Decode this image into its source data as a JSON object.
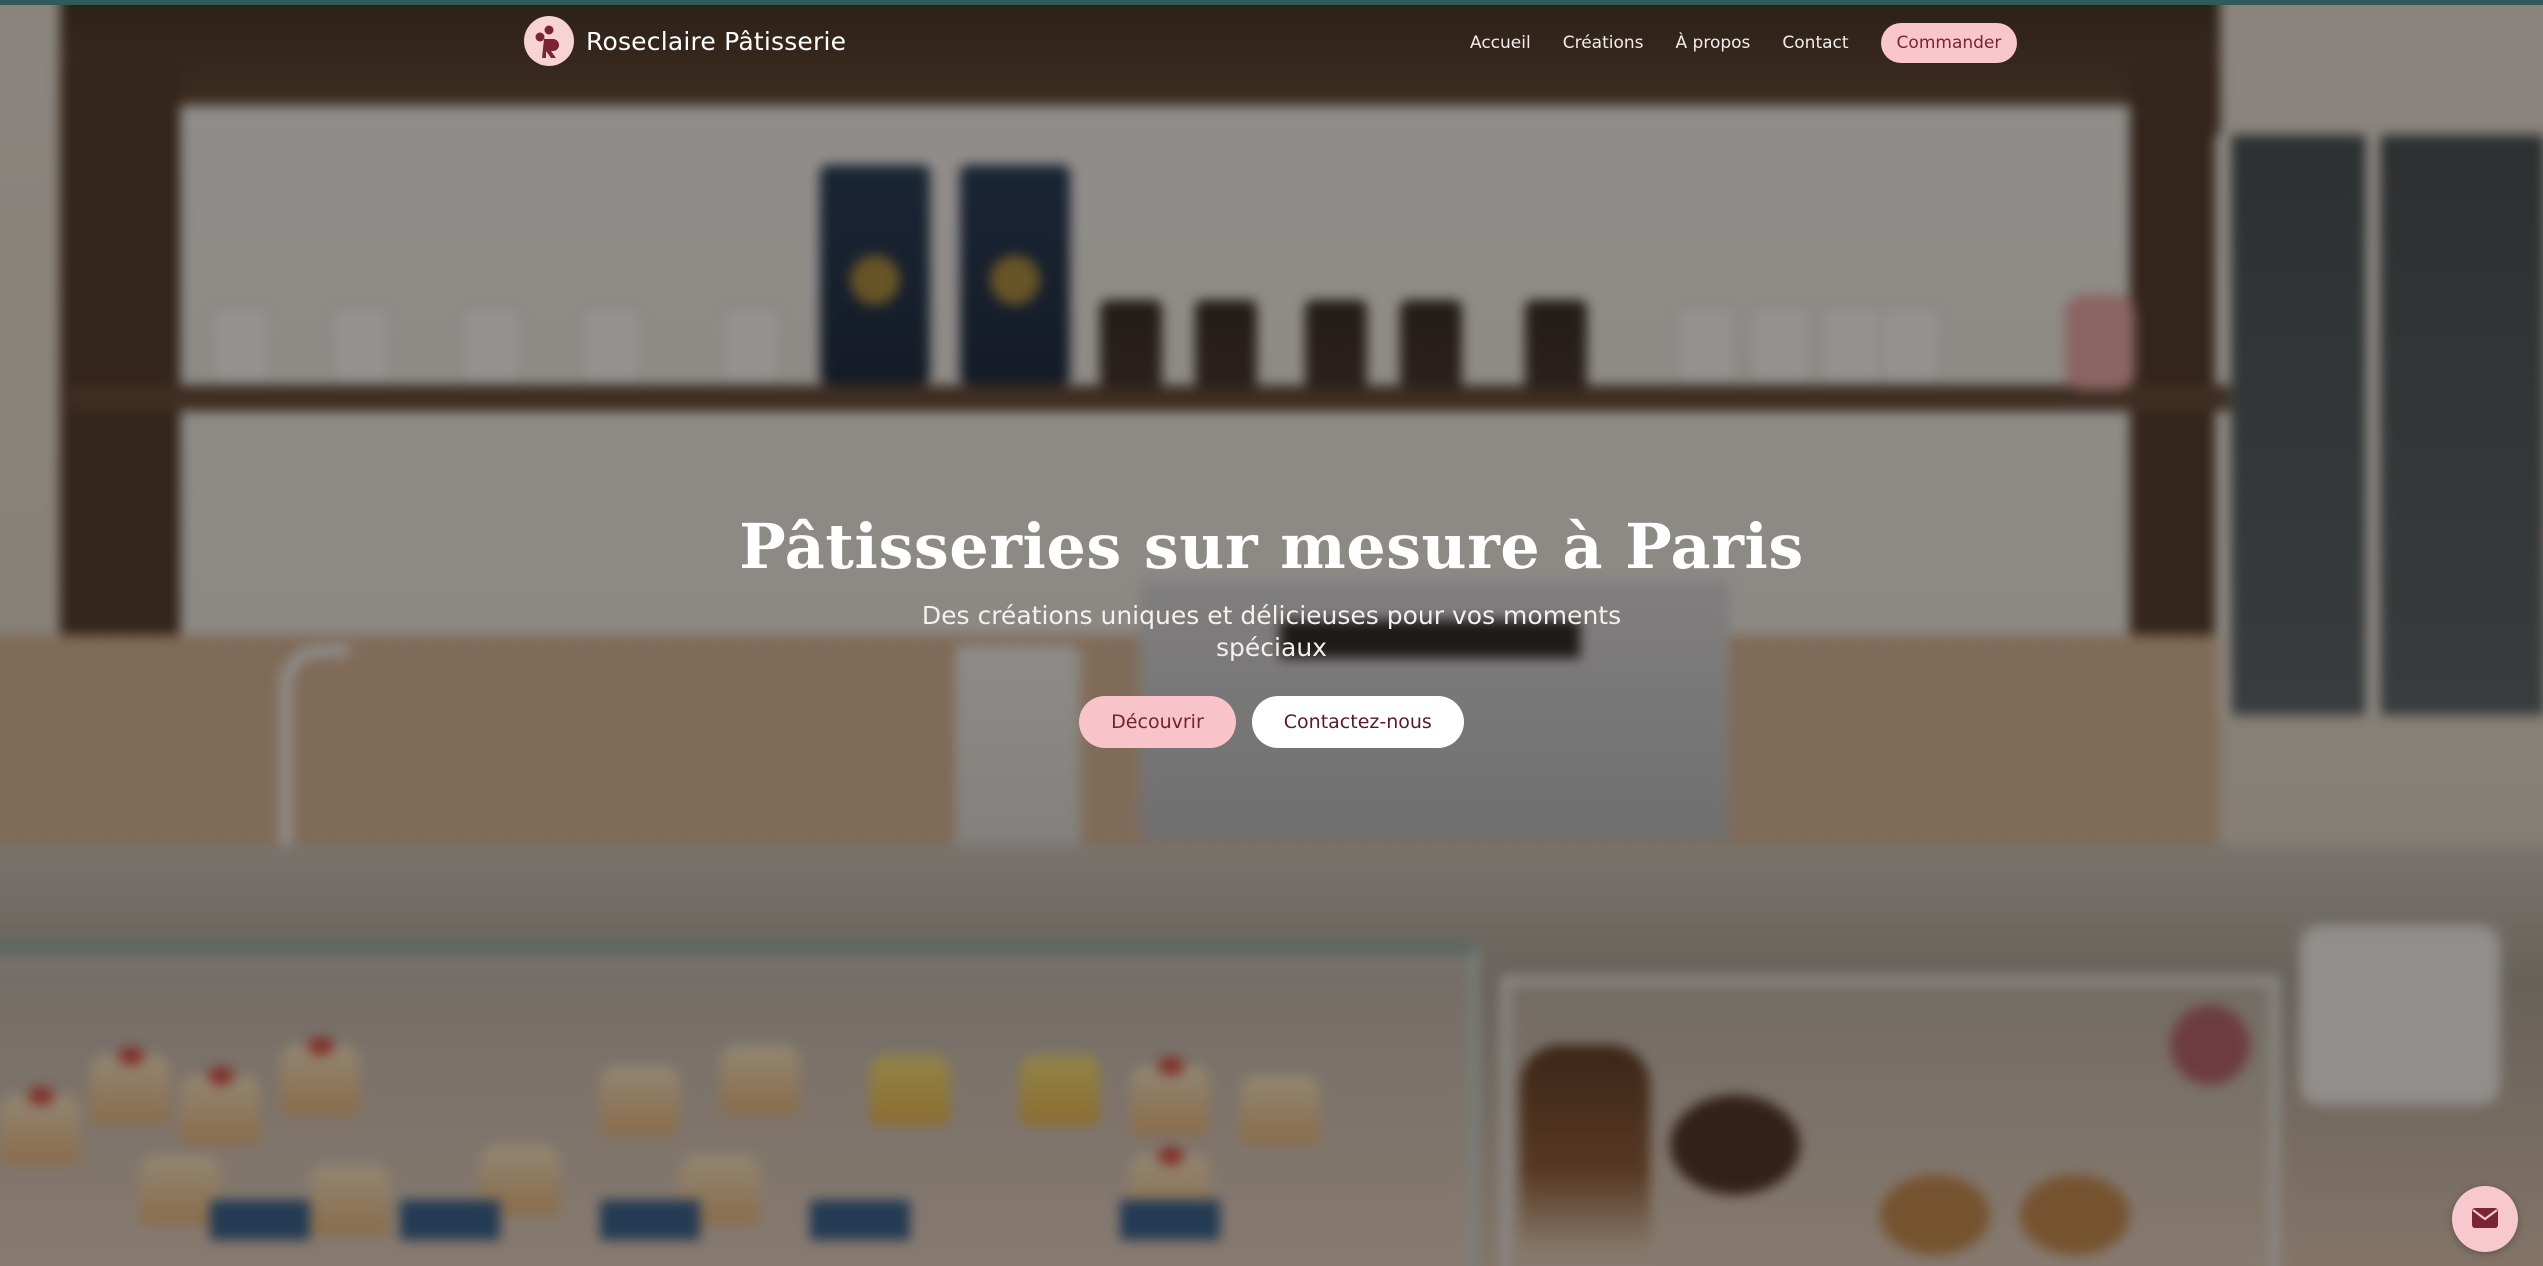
{
  "brand": {
    "name": "Roseclaire Pâtisserie",
    "logo_icon": "roseclaire-logo-icon"
  },
  "nav": {
    "items": [
      {
        "label": "Accueil"
      },
      {
        "label": "Créations"
      },
      {
        "label": "À propos"
      },
      {
        "label": "Contact"
      }
    ],
    "cta_label": "Commander"
  },
  "hero": {
    "title": "Pâtisseries sur mesure à Paris",
    "subtitle": "Des créations uniques et délicieuses pour vos moments spéciaux",
    "primary_button": "Découvrir",
    "secondary_button": "Contactez-nous",
    "background_image": "blurred-bakery-interior"
  },
  "floating_button": {
    "icon": "envelope-icon"
  },
  "colors": {
    "accent_pink": "#f8c4ca",
    "accent_dark": "#6e2232",
    "top_strip": "#2f5a5a"
  }
}
